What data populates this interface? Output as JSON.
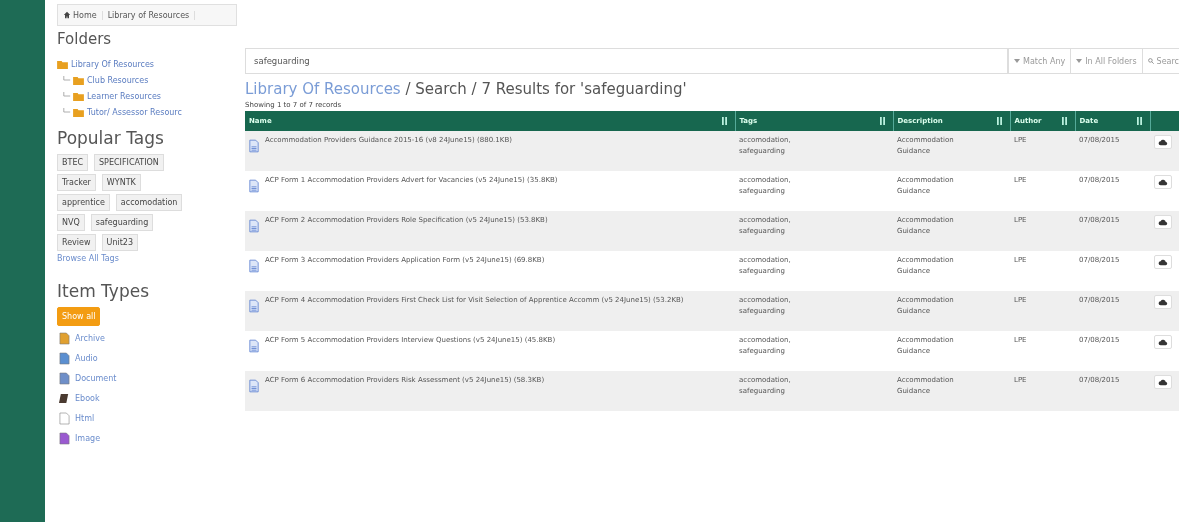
{
  "breadcrumb": [
    {
      "label": "Home"
    },
    {
      "label": "Library of Resources"
    }
  ],
  "folders": {
    "title": "Folders",
    "tree": [
      {
        "label": "Library Of Resources",
        "children": [
          {
            "label": "Club Resources"
          },
          {
            "label": "Learner Resources"
          },
          {
            "label": "Tutor/ Assessor Resourc"
          }
        ]
      }
    ]
  },
  "popular_tags": {
    "title": "Popular Tags",
    "tags": [
      [
        "BTEC",
        "SPECIFICATION"
      ],
      [
        "Tracker",
        "WYNTK"
      ],
      [
        "apprentice",
        "accomodation"
      ],
      [
        "NVQ",
        "safeguarding"
      ],
      [
        "Review",
        "Unit23"
      ]
    ],
    "browse_link": "Browse All Tags"
  },
  "item_types": {
    "title": "Item Types",
    "items": [
      {
        "label": "Show all",
        "kind": "all",
        "selected": true
      },
      {
        "label": "Archive",
        "kind": "archive",
        "selected": false
      },
      {
        "label": "Audio",
        "kind": "audio",
        "selected": false
      },
      {
        "label": "Document",
        "kind": "document",
        "selected": false
      },
      {
        "label": "Ebook",
        "kind": "ebook",
        "selected": false
      },
      {
        "label": "Html",
        "kind": "html",
        "selected": false
      },
      {
        "label": "Image",
        "kind": "image",
        "selected": false
      }
    ]
  },
  "search": {
    "value": "safeguarding",
    "match": "Match Any",
    "scope": "In All Folders",
    "button": "Searc"
  },
  "heading": {
    "link": "Library Of Resources",
    "rest": " / Search / 7 Results for 'safeguarding'"
  },
  "records_info": "Showing 1 to 7 of 7 records",
  "table": {
    "columns": [
      "Name",
      "Tags",
      "Description",
      "Author",
      "Date"
    ],
    "rows": [
      {
        "name": "Accommodation Providers Guidance 2015-16 (v8 24June15) (880.1KB)",
        "tags": "accomodation, safeguarding",
        "description": "Accommodation Guidance",
        "author": "LPE",
        "date": "07/08/2015"
      },
      {
        "name": "ACP Form 1 Accommodation Providers Advert for Vacancies (v5 24June15) (35.8KB)",
        "tags": "accomodation, safeguarding",
        "description": "Accommodation Guidance",
        "author": "LPE",
        "date": "07/08/2015"
      },
      {
        "name": "ACP Form 2 Accommodation Providers Role Specification (v5 24June15) (53.8KB)",
        "tags": "accomodation, safeguarding",
        "description": "Accommodation Guidance",
        "author": "LPE",
        "date": "07/08/2015"
      },
      {
        "name": "ACP Form 3 Accommodation Providers Application Form (v5 24June15) (69.8KB)",
        "tags": "accomodation, safeguarding",
        "description": "Accommodation Guidance",
        "author": "LPE",
        "date": "07/08/2015"
      },
      {
        "name": "ACP Form 4 Accommodation Providers First Check List for Visit Selection of Apprentice Accomm (v5 24June15) (53.2KB)",
        "tags": "accomodation, safeguarding",
        "description": "Accommodation Guidance",
        "author": "LPE",
        "date": "07/08/2015"
      },
      {
        "name": "ACP Form 5 Accommodation Providers Interview Questions (v5 24June15) (45.8KB)",
        "tags": "accomodation, safeguarding",
        "description": "Accommodation Guidance",
        "author": "LPE",
        "date": "07/08/2015"
      },
      {
        "name": "ACP Form 6 Accommodation Providers Risk Assessment (v5 24June15) (58.3KB)",
        "tags": "accomodation, safeguarding",
        "description": "Accommodation Guidance",
        "author": "LPE",
        "date": "07/08/2015"
      }
    ]
  }
}
